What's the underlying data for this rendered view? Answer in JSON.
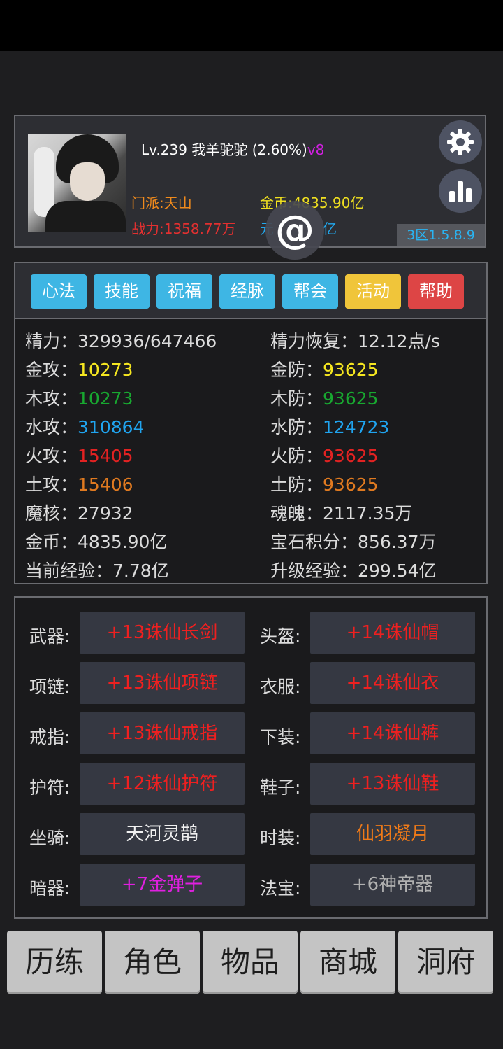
{
  "header": {
    "level_text": "Lv.239",
    "player_name": "我羊驼驼",
    "exp_percent": "(2.60%)",
    "vip": "v8",
    "sect": "门派:天山",
    "power": "战力:1358.77万",
    "gold": "金币:4835.90亿",
    "gem": "元",
    "gem_suffix": "亿",
    "region": "3区1.5.8.9",
    "settings_icon": "gear-icon",
    "stats_icon": "bar-chart-icon",
    "float_icon": "at-sign-icon"
  },
  "tabs": [
    {
      "label": "心法",
      "color": "#3eb6e4"
    },
    {
      "label": "技能",
      "color": "#3eb6e4"
    },
    {
      "label": "祝福",
      "color": "#3eb6e4"
    },
    {
      "label": "经脉",
      "color": "#3eb6e4"
    },
    {
      "label": "帮会",
      "color": "#3eb6e4"
    },
    {
      "label": "活动",
      "color": "#f0c53a"
    },
    {
      "label": "帮助",
      "color": "#dd4545"
    }
  ],
  "attributes": {
    "left": [
      {
        "label": "精力：",
        "value": "329936/647466"
      },
      {
        "label": "金攻：",
        "value": "10273"
      },
      {
        "label": "木攻：",
        "value": "10273"
      },
      {
        "label": "水攻：",
        "value": "310864"
      },
      {
        "label": "火攻：",
        "value": "15405"
      },
      {
        "label": "土攻：",
        "value": "15406"
      },
      {
        "label": "魔核：",
        "value": "27932"
      },
      {
        "label": "金币：",
        "value": "4835.90亿"
      },
      {
        "label": "当前经验：",
        "value": "7.78亿"
      }
    ],
    "right": [
      {
        "label": "精力恢复：",
        "value": "12.12点/s"
      },
      {
        "label": "金防：",
        "value": "93625"
      },
      {
        "label": "木防：",
        "value": "93625"
      },
      {
        "label": "水防：",
        "value": "124723"
      },
      {
        "label": "火防：",
        "value": "93625"
      },
      {
        "label": "土防：",
        "value": "93625"
      },
      {
        "label": "魂魄：",
        "value": "2117.35万"
      },
      {
        "label": "宝石积分：",
        "value": "856.37万"
      },
      {
        "label": "升级经验：",
        "value": "299.54亿"
      }
    ]
  },
  "equipment": {
    "left": [
      {
        "slot": "武器:",
        "item": "+13诛仙长剑"
      },
      {
        "slot": "项链:",
        "item": "+13诛仙项链"
      },
      {
        "slot": "戒指:",
        "item": "+13诛仙戒指"
      },
      {
        "slot": "护符:",
        "item": "+12诛仙护符"
      },
      {
        "slot": "坐骑:",
        "item": "天河灵鹊"
      },
      {
        "slot": "暗器:",
        "item": "+7金弹子"
      }
    ],
    "right": [
      {
        "slot": "头盔:",
        "item": "+14诛仙帽"
      },
      {
        "slot": "衣服:",
        "item": "+14诛仙衣"
      },
      {
        "slot": "下装:",
        "item": "+14诛仙裤"
      },
      {
        "slot": "鞋子:",
        "item": "+13诛仙鞋"
      },
      {
        "slot": "时装:",
        "item": "仙羽凝月"
      },
      {
        "slot": "法宝:",
        "item": "+6神帝器"
      }
    ]
  },
  "nav": [
    "历练",
    "角色",
    "物品",
    "商城",
    "洞府"
  ]
}
